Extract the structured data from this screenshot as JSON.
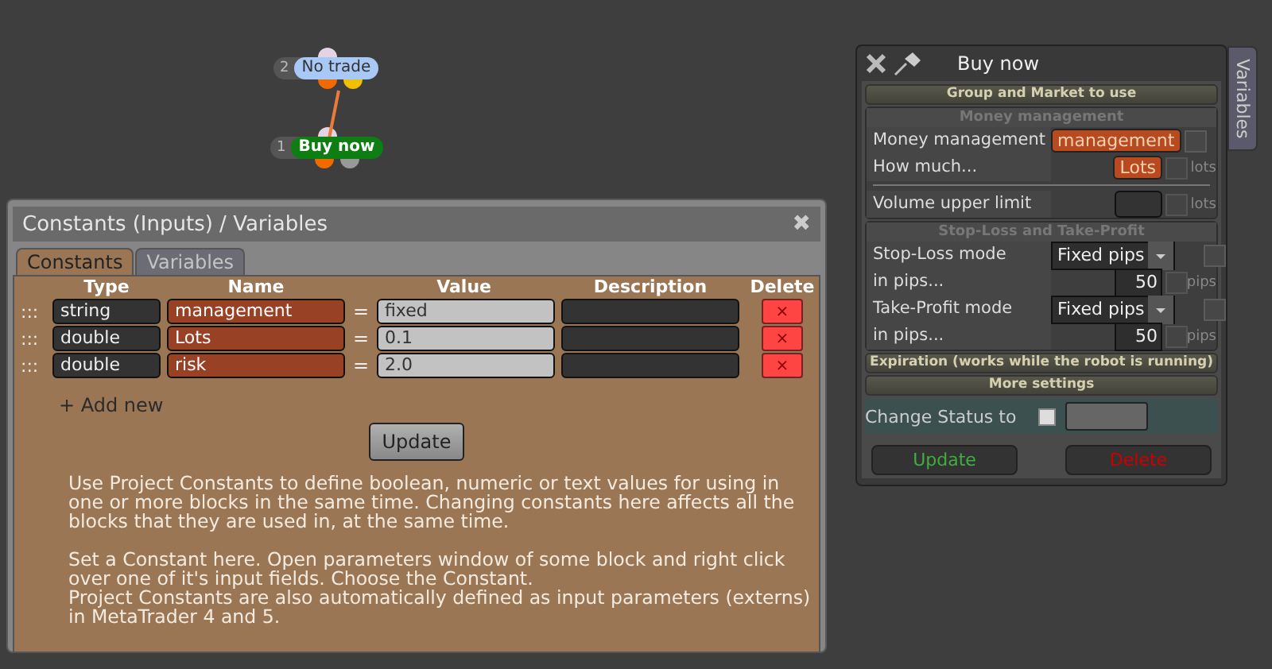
{
  "canvas": {
    "nodes": [
      {
        "number": "2",
        "label": "No trade",
        "kind": "idle"
      },
      {
        "number": "1",
        "label": "Buy now",
        "kind": "active"
      }
    ]
  },
  "constants_window": {
    "title": "Constants (Inputs) / Variables",
    "close": "✖",
    "tabs": [
      {
        "label": "Constants",
        "selected": true
      },
      {
        "label": "Variables",
        "selected": false
      }
    ],
    "columns": [
      "Type",
      "Name",
      "Value",
      "Description",
      "Delete"
    ],
    "rows": [
      {
        "grip": ":::",
        "type": "string",
        "name": "management",
        "equals": "=",
        "value": "fixed",
        "delete": "×"
      },
      {
        "grip": ":::",
        "type": "double",
        "name": "Lots",
        "equals": "=",
        "value": "0.1",
        "delete": "×"
      },
      {
        "grip": ":::",
        "type": "double",
        "name": "risk",
        "equals": "=",
        "value": "2.0",
        "delete": "×"
      }
    ],
    "add_new": "+ Add new",
    "update": "Update",
    "help": [
      [
        "Use Project Constants to define boolean, numeric or text values for using in one or more blocks in the same time. Changing constants here affects all the blocks that they are used in, at the same time."
      ],
      [
        "Set a Constant here. Open parameters window of some block and right click over one of it's input fields. Choose the Constant.",
        "Project Constants are also automatically defined as input parameters (externs) in MetaTrader 4 and 5."
      ]
    ]
  },
  "block_window": {
    "title": "Buy now",
    "side_tab": "Variables",
    "section_header": "Group and Market to use",
    "panels": [
      {
        "title": "Money management",
        "groups": [
          [
            {
              "label": "Money management",
              "kind": "variable",
              "value": "management",
              "checked": false
            },
            {
              "label": "How much...",
              "kind": "variable",
              "value": "Lots",
              "checked": false,
              "unit": "lots"
            }
          ],
          [
            {
              "label": "Volume upper limit",
              "kind": "empty",
              "checked": false,
              "unit": "lots"
            }
          ]
        ]
      },
      {
        "title": "Stop-Loss and Take-Profit",
        "groups": [
          [
            {
              "label": "Stop-Loss mode",
              "kind": "select",
              "value": "Fixed pips",
              "checked": false
            },
            {
              "label": "in pips...",
              "kind": "number",
              "value": "50",
              "checked": false,
              "unit": "pips"
            },
            {
              "label": "Take-Profit mode",
              "kind": "select",
              "value": "Fixed pips",
              "checked": false
            },
            {
              "label": "in pips...",
              "kind": "number",
              "value": "50",
              "checked": false,
              "unit": "pips"
            }
          ]
        ]
      }
    ],
    "collapsed_sections": [
      "Expiration (works while the robot is running)",
      "More settings"
    ],
    "status": {
      "label": "Change Status to",
      "checked": false
    },
    "buttons": [
      {
        "label": "Update",
        "kind": "update"
      },
      {
        "label": "Delete",
        "kind": "delete"
      }
    ]
  }
}
